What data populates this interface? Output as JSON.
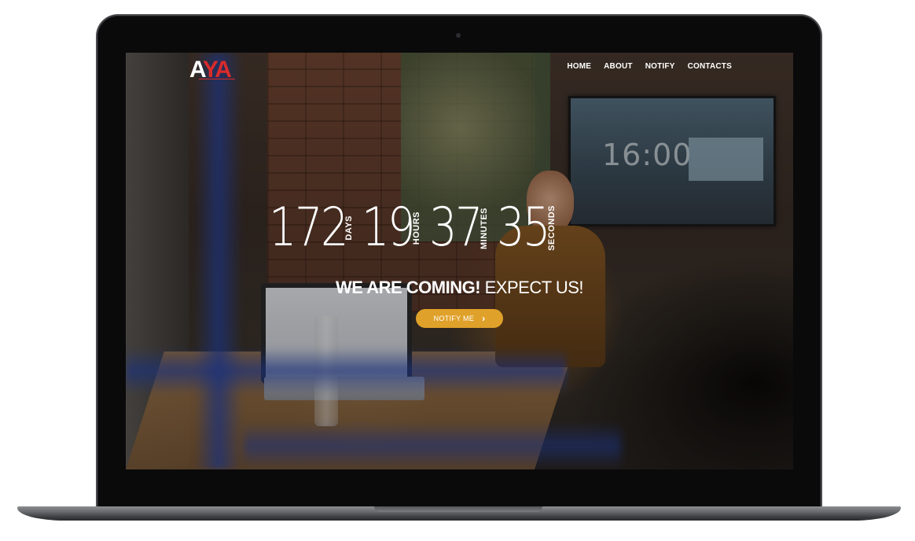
{
  "logo": {
    "text_a": "A",
    "text_y": "Y",
    "text_a2": "A"
  },
  "nav": {
    "items": [
      {
        "label": "HOME"
      },
      {
        "label": "ABOUT"
      },
      {
        "label": "NOTIFY"
      },
      {
        "label": "CONTACTS"
      }
    ]
  },
  "countdown": {
    "days": {
      "value": "172",
      "label": "DAYS"
    },
    "hours": {
      "value": "19",
      "label": "HOURS"
    },
    "minutes": {
      "value": "37",
      "label": "MINUTES"
    },
    "seconds": {
      "value": "35",
      "label": "SECONDS"
    }
  },
  "hero": {
    "headline_strong": "WE ARE COMING!",
    "headline_rest": " EXPECT US!",
    "button_label": "NOTIFY ME",
    "button_color": "#e0a12a"
  },
  "background_photo": {
    "tv_clock": "16:00"
  },
  "brand": {
    "accent": "#d92b2b"
  }
}
